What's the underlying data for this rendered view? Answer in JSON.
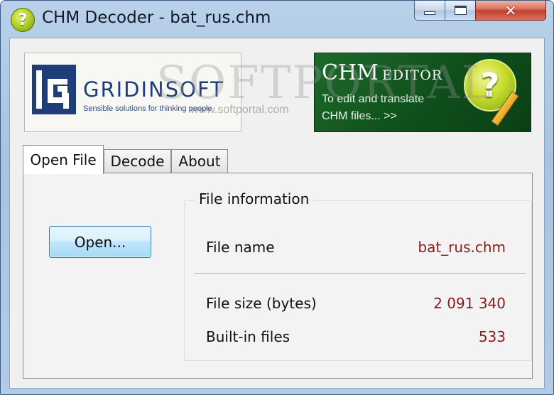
{
  "window": {
    "title": "CHM Decoder - bat_rus.chm",
    "icon": "question-icon",
    "controls": {
      "minimize": "minimize-icon",
      "maximize": "maximize-icon",
      "close": "close-icon",
      "close_glyph": "✕"
    }
  },
  "banners": {
    "left": {
      "brand": "GRIDINSOFT",
      "tagline": "Sensible solutions for thinking people"
    },
    "right": {
      "title_big": "CHM",
      "title_small": "EDITOR",
      "line1": "To edit and translate",
      "line2": "CHM files... >>",
      "badge": "?"
    },
    "watermark": {
      "text": "SOFTPORTAL",
      "url": "www.softportal.com"
    }
  },
  "tabs": [
    {
      "label": "Open File",
      "active": true
    },
    {
      "label": "Decode",
      "active": false
    },
    {
      "label": "About",
      "active": false
    }
  ],
  "open_panel": {
    "open_button": "Open...",
    "file_info": {
      "legend": "File information",
      "rows": [
        {
          "label": "File name",
          "value": "bat_rus.chm"
        },
        {
          "label": "File size (bytes)",
          "value": "2 091 340"
        },
        {
          "label": "Built-in files",
          "value": "533"
        }
      ]
    }
  },
  "colors": {
    "accent_value": "#8b1a1a",
    "brand_blue": "#1f3d7a",
    "promo_green": "#1d6b2a"
  }
}
